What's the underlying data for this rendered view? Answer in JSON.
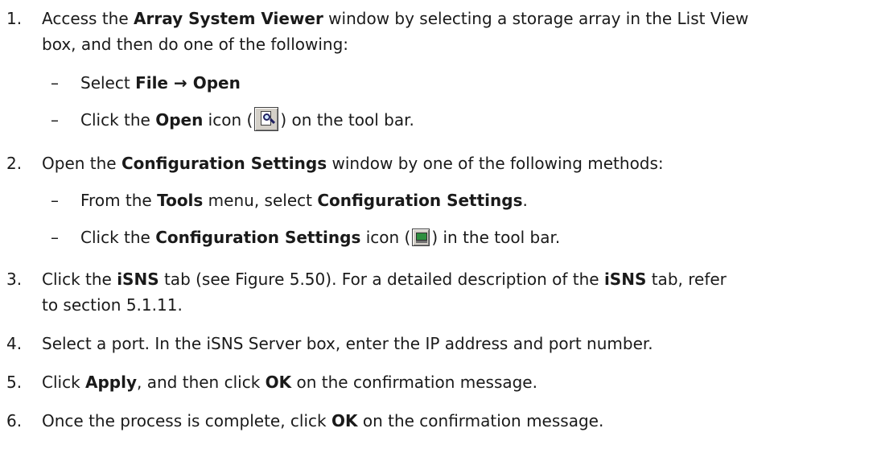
{
  "steps": [
    {
      "number": "1.",
      "line1": {
        "t1": "Access the ",
        "b1": "Array System Viewer",
        "t2": " window by selecting a storage array in the List View"
      },
      "line2": "box, and then do one of the following:",
      "subs": [
        {
          "dash": "–",
          "t1": "Select ",
          "b1": "File",
          "arrow": " → ",
          "b2": "Open"
        },
        {
          "dash": "–",
          "t1": "Click the ",
          "b1": "Open",
          "t2": " icon (",
          "icon": "open-magnifier-icon",
          "t3": ") on the tool bar."
        }
      ]
    },
    {
      "number": "2.",
      "line1": {
        "t1": "Open the ",
        "b1": "Configuration Settings",
        "t2": " window by one of the following methods:"
      },
      "subs": [
        {
          "dash": "–",
          "t1": "From the ",
          "b1": "Tools",
          "t2": " menu, select ",
          "b2": "Configuration Settings",
          "t3": "."
        },
        {
          "dash": "–",
          "t1": "Click the ",
          "b1": "Configuration Settings",
          "t2": " icon (",
          "icon": "configuration-settings-icon",
          "t3": ") in the tool bar."
        }
      ]
    },
    {
      "number": "3.",
      "line1": {
        "t1": "Click the ",
        "b1": "iSNS",
        "t2": " tab (see Figure 5.50). For a detailed description of the ",
        "b2": "iSNS",
        "t3": " tab, refer"
      },
      "line2": "to section 5.1.11."
    },
    {
      "number": "4.",
      "line1": {
        "t1": "Select a port. In the iSNS Server box, enter the IP address and port number."
      }
    },
    {
      "number": "5.",
      "line1": {
        "t1": "Click ",
        "b1": "Apply",
        "t2": ", and then click ",
        "b2": "OK",
        "t3": " on the confirmation message."
      }
    },
    {
      "number": "6.",
      "line1": {
        "t1": "Once the process is complete, click ",
        "b1": "OK",
        "t2": " on the confirmation message."
      }
    }
  ]
}
